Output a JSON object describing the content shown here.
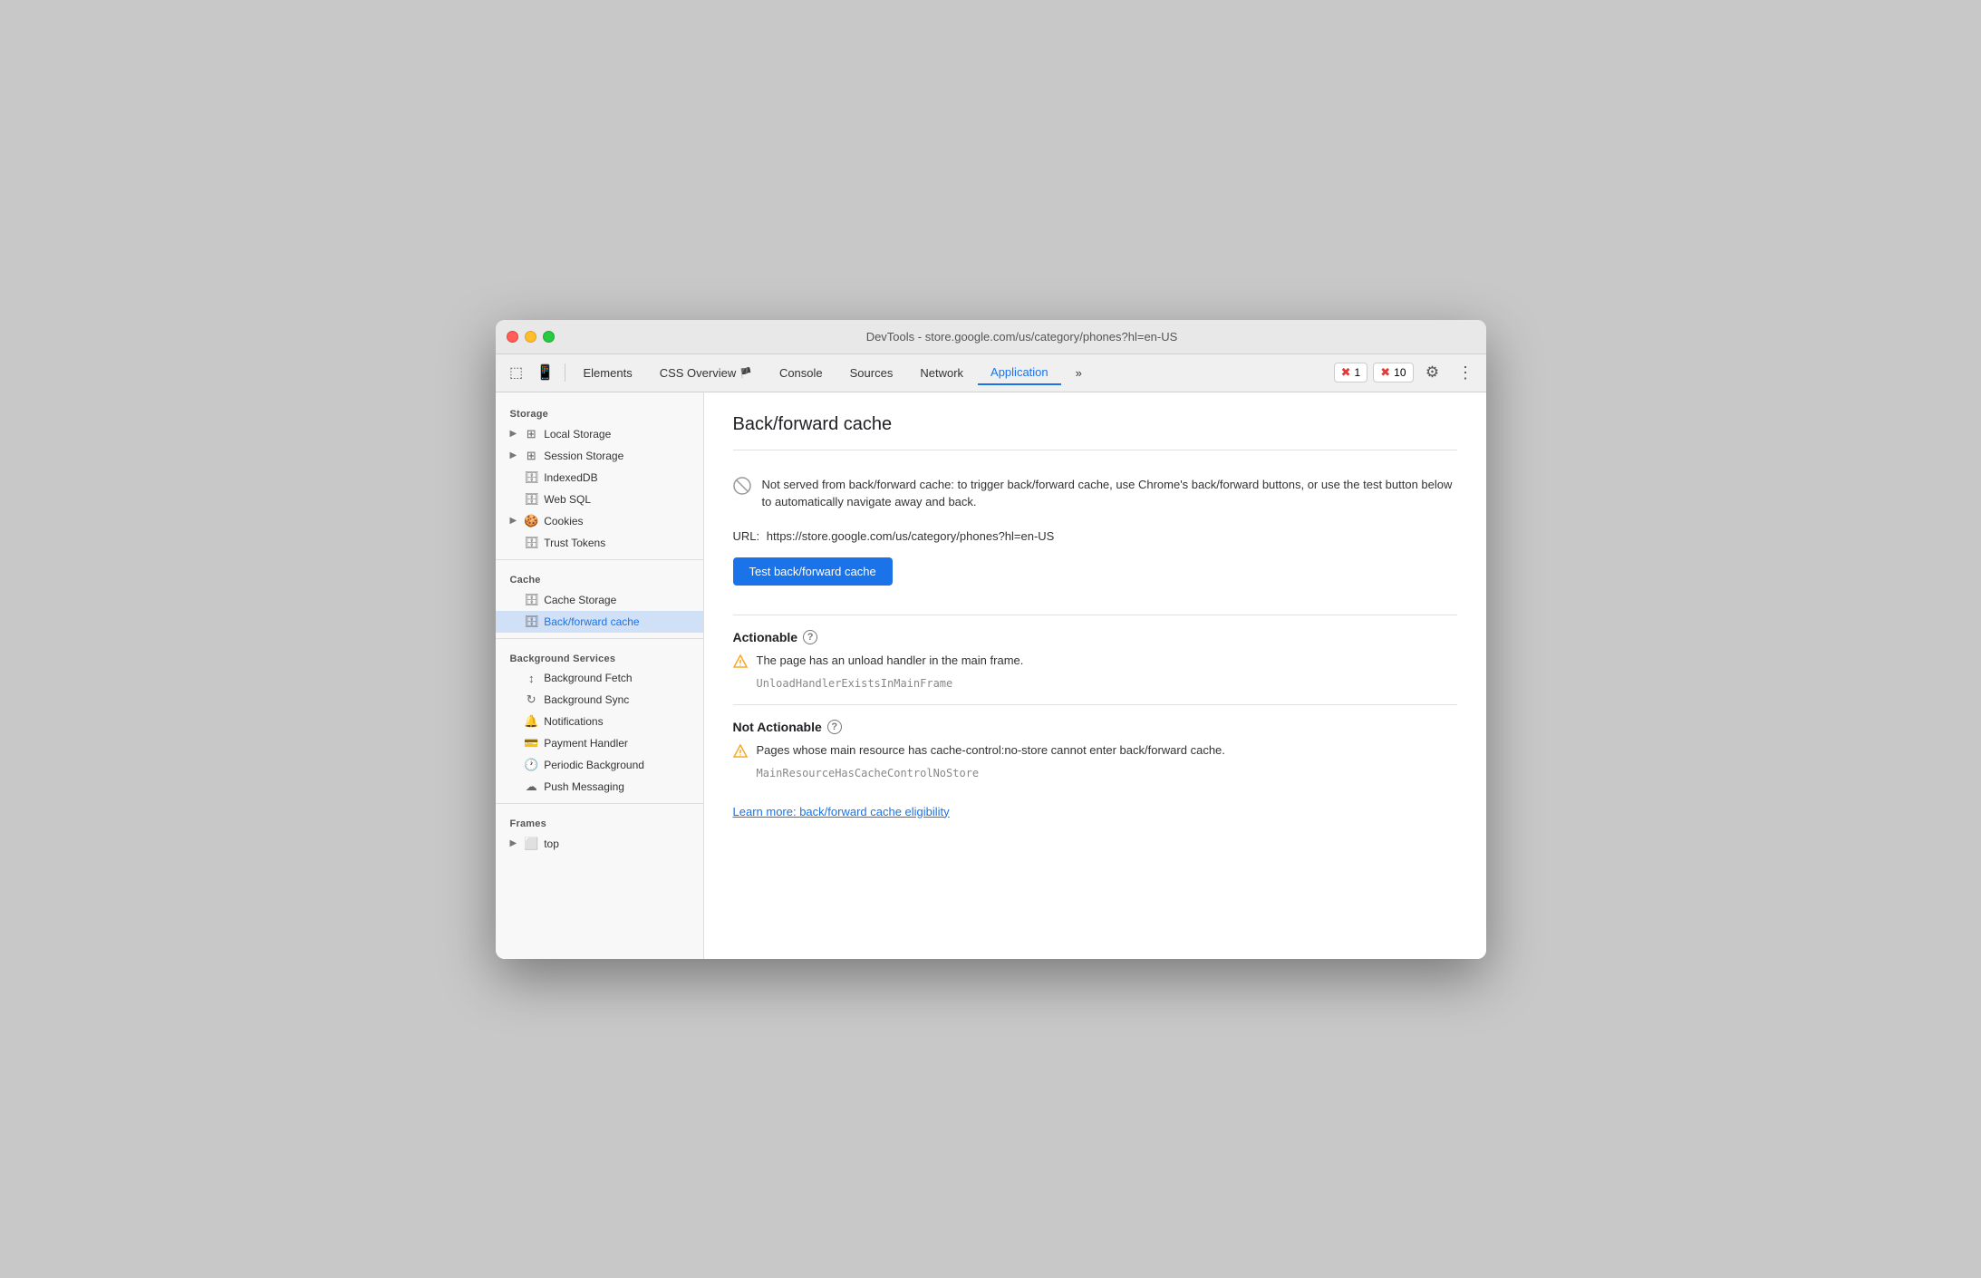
{
  "window": {
    "title": "DevTools - store.google.com/us/category/phones?hl=en-US"
  },
  "toolbar": {
    "tabs": [
      {
        "id": "elements",
        "label": "Elements",
        "active": false
      },
      {
        "id": "css-overview",
        "label": "CSS Overview",
        "active": false,
        "icon": "🏴"
      },
      {
        "id": "console",
        "label": "Console",
        "active": false
      },
      {
        "id": "sources",
        "label": "Sources",
        "active": false
      },
      {
        "id": "network",
        "label": "Network",
        "active": false
      },
      {
        "id": "application",
        "label": "Application",
        "active": true
      },
      {
        "id": "more",
        "label": "»",
        "active": false
      }
    ],
    "error_count": "1",
    "warning_count": "10",
    "more_tabs_label": "»"
  },
  "sidebar": {
    "sections": [
      {
        "label": "Storage",
        "items": [
          {
            "id": "local-storage",
            "label": "Local Storage",
            "icon": "grid",
            "expandable": true
          },
          {
            "id": "session-storage",
            "label": "Session Storage",
            "icon": "grid",
            "expandable": true
          },
          {
            "id": "indexeddb",
            "label": "IndexedDB",
            "icon": "cylinder",
            "expandable": false
          },
          {
            "id": "web-sql",
            "label": "Web SQL",
            "icon": "cylinder",
            "expandable": false
          },
          {
            "id": "cookies",
            "label": "Cookies",
            "icon": "cookie",
            "expandable": true
          },
          {
            "id": "trust-tokens",
            "label": "Trust Tokens",
            "icon": "cylinder",
            "expandable": false
          }
        ]
      },
      {
        "label": "Cache",
        "items": [
          {
            "id": "cache-storage",
            "label": "Cache Storage",
            "icon": "cylinder",
            "expandable": false
          },
          {
            "id": "back-forward-cache",
            "label": "Back/forward cache",
            "icon": "cylinder",
            "expandable": false,
            "active": true
          }
        ]
      },
      {
        "label": "Background Services",
        "items": [
          {
            "id": "background-fetch",
            "label": "Background Fetch",
            "icon": "arrows",
            "expandable": false
          },
          {
            "id": "background-sync",
            "label": "Background Sync",
            "icon": "sync",
            "expandable": false
          },
          {
            "id": "notifications",
            "label": "Notifications",
            "icon": "bell",
            "expandable": false
          },
          {
            "id": "payment-handler",
            "label": "Payment Handler",
            "icon": "card",
            "expandable": false
          },
          {
            "id": "periodic-background",
            "label": "Periodic Background",
            "icon": "clock",
            "expandable": false
          },
          {
            "id": "push-messaging",
            "label": "Push Messaging",
            "icon": "cloud",
            "expandable": false
          }
        ]
      },
      {
        "label": "Frames",
        "items": [
          {
            "id": "top",
            "label": "top",
            "icon": "frame",
            "expandable": true
          }
        ]
      }
    ]
  },
  "content": {
    "title": "Back/forward cache",
    "not_served_message": "Not served from back/forward cache: to trigger back/forward cache, use Chrome's back/forward buttons, or use the test button below to automatically navigate away and back.",
    "url_label": "URL:",
    "url_value": "https://store.google.com/us/category/phones?hl=en-US",
    "test_button_label": "Test back/forward cache",
    "actionable_label": "Actionable",
    "actionable_warning": "The page has an unload handler in the main frame.",
    "actionable_code": "UnloadHandlerExistsInMainFrame",
    "not_actionable_label": "Not Actionable",
    "not_actionable_warning": "Pages whose main resource has cache-control:no-store cannot enter back/forward cache.",
    "not_actionable_code": "MainResourceHasCacheControlNoStore",
    "learn_more_link": "Learn more: back/forward cache eligibility"
  }
}
